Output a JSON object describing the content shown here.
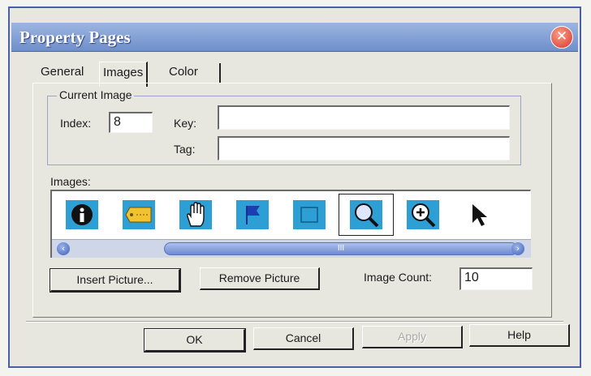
{
  "window": {
    "title": "Property Pages",
    "close_symbol": "✕"
  },
  "tabs": [
    {
      "label": "General",
      "active": false
    },
    {
      "label": "Images",
      "active": true
    },
    {
      "label": "Color",
      "active": false
    }
  ],
  "current_image": {
    "group_label": "Current Image",
    "index_label": "Index:",
    "index_value": "8",
    "key_label": "Key:",
    "key_value": "",
    "tag_label": "Tag:",
    "tag_value": ""
  },
  "images": {
    "label": "Images:",
    "icons": [
      "info-icon",
      "tag-icon",
      "hand-icon",
      "flag-icon",
      "square-icon",
      "magnifier-icon",
      "zoom-in-icon",
      "arrow-pointer-icon"
    ],
    "selected_index": 5,
    "scroll_thumb_mark": "III"
  },
  "buttons": {
    "insert_picture": "Insert Picture...",
    "remove_picture": "Remove Picture",
    "ok": "OK",
    "cancel": "Cancel",
    "apply": "Apply",
    "help": "Help"
  },
  "image_count": {
    "label": "Image Count:",
    "value": "10"
  },
  "colors": {
    "title_bar": "#7f9bd2",
    "tile_blue": "#2d9fd4",
    "dialog_bg": "#e7e6df"
  }
}
